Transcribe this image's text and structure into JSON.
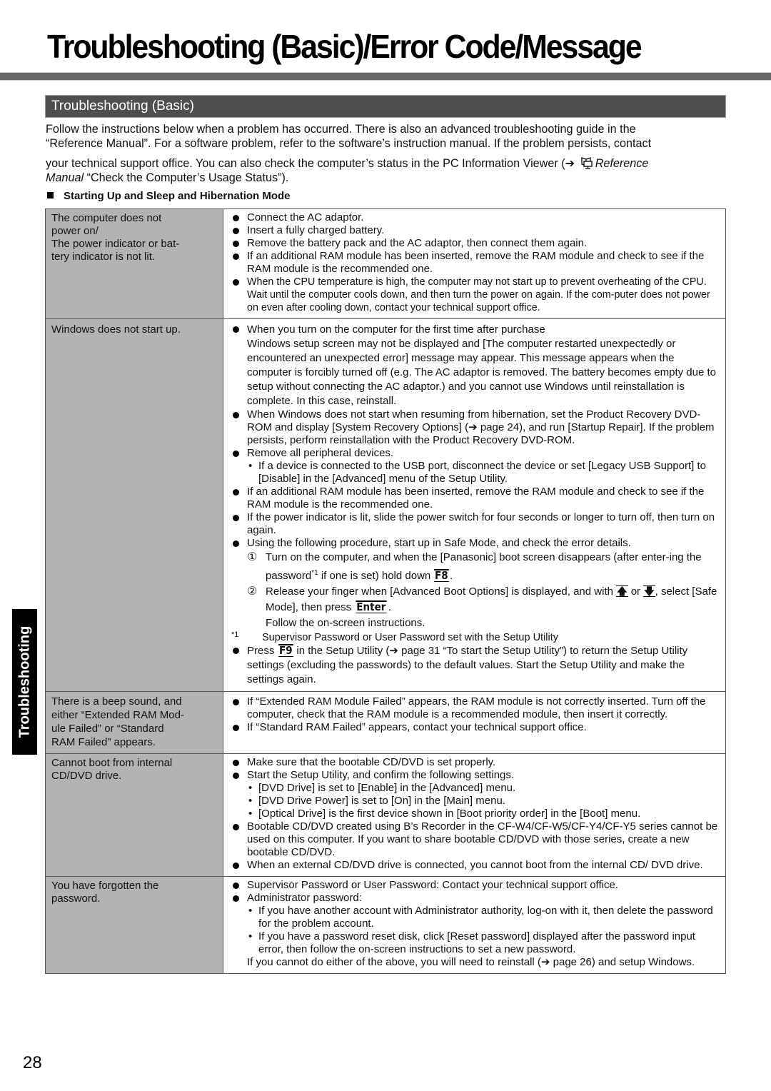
{
  "page": {
    "title": "Troubleshooting (Basic)/Error Code/Message",
    "section_title": "Troubleshooting (Basic)",
    "side_tab": "Troubleshooting",
    "page_number": "28"
  },
  "intro": {
    "line1": "Follow the instructions below when a problem has occurred. There is also an advanced troubleshooting guide in the",
    "line2": "“Reference Manual”. For a software problem, refer to the software’s instruction manual. If the problem persists, contact",
    "line3_pre": "your technical support office. You can also check the computer’s status in the PC Information Viewer (",
    "line3_arrow": "➔",
    "reference_icon": "reference-manual-icon",
    "line3_italic": "Reference",
    "line4_italic": "Manual",
    "line4_rest": " “Check the Computer’s Usage Status”)."
  },
  "subsection": {
    "title": "Starting Up and Sleep and Hibernation Mode"
  },
  "rows": [
    {
      "problem": [
        "The computer does not",
        "power on/",
        "The power indicator or bat-",
        "tery indicator is not lit."
      ],
      "solutions": [
        "Connect the AC adaptor.",
        "Insert a fully charged battery.",
        "Remove the battery pack and the AC adaptor, then connect them again.",
        "If an additional RAM module has been inserted, remove the RAM module and check to see if the RAM module is the recommended one.",
        "When the CPU temperature is high, the computer may not start up to prevent overheating of the CPU. Wait until the computer cools down, and then turn the power on again. If the com-puter does not power on even after cooling down, contact your technical support office."
      ]
    },
    {
      "problem": [
        "Windows does not start up."
      ],
      "solutions": {
        "s1_head": "When you turn on the computer for the first time after purchase",
        "s1_body": "Windows setup screen may not be displayed and [The computer restarted unexpectedly or encountered an unexpected error] message may appear. This message appears when the computer is forcibly turned off (e.g. The AC adaptor is removed. The battery becomes empty due to setup without connecting the AC adaptor.) and you cannot use Windows until reinstallation is complete. In this case, reinstall.",
        "s2": "When Windows does not start when resuming from hibernation, set the Product Recovery DVD-ROM and display [System Recovery Options] (➔ page 24), and run [Startup Repair]. If the problem persists, perform reinstallation with the Product Recovery DVD-ROM.",
        "s3": "Remove all peripheral devices.",
        "s3_sub": "If a device is connected to the USB port, disconnect the device or set [Legacy USB Support] to [Disable] in the [Advanced] menu of the Setup Utility.",
        "s4": "If an additional RAM module has been inserted, remove the RAM module and check to see if the RAM module is the recommended one.",
        "s5": "If the power indicator is lit, slide the power switch for four seconds or longer to turn off, then turn on again.",
        "s6": "Using the following procedure, start up in Safe Mode, and check the error details.",
        "step1_num": "①",
        "step1_pre": "Turn on the computer, and when the [Panasonic] boot screen disappears (after enter-ing the password",
        "step1_sup": "*1",
        "step1_mid": " if one is set) hold down ",
        "step1_key": "F8",
        "step1_end": ".",
        "step2_num": "②",
        "step2_pre": "Release your finger when [Advanced Boot Options] is displayed, and with ",
        "step2_key_up": "🡅",
        "step2_or": " or ",
        "step2_key_down": "🡇",
        "step2_mid": ", select [Safe Mode], then press ",
        "step2_key_enter": "Enter",
        "step2_end": ".",
        "step2_follow": "Follow the on-screen instructions.",
        "footnote_mark": "*1",
        "footnote_text": "Supervisor Password or User Password set with the Setup Utility",
        "s7_pre": "Press ",
        "s7_key": "F9",
        "s7_post": " in the Setup Utility (➔ page 31 “To start the Setup Utility”) to return the Setup Utility settings (excluding the passwords) to the default values. Start the Setup Utility and make the settings again."
      }
    },
    {
      "problem": [
        "There is a beep sound, and",
        "either “Extended RAM Mod-",
        "ule Failed” or “Standard",
        "RAM Failed” appears."
      ],
      "solutions": [
        "If “Extended RAM Module Failed” appears, the RAM module is not correctly inserted. Turn off the computer, check that the RAM module is a recommended module, then insert it correctly.",
        "If “Standard RAM Failed” appears, contact your technical support office."
      ]
    },
    {
      "problem": [
        "Cannot boot from internal",
        "CD/DVD drive."
      ],
      "solutions": {
        "s1": "Make sure that the bootable CD/DVD is set properly.",
        "s2": "Start the Setup Utility, and confirm the following settings.",
        "s2_sub": [
          "[DVD Drive] is set to [Enable] in the [Advanced] menu.",
          "[DVD Drive Power] is set to [On] in the [Main] menu.",
          "[Optical Drive] is the first device shown in [Boot priority order] in the [Boot] menu."
        ],
        "s3": "Bootable CD/DVD created using B’s Recorder in the CF-W4/CF-W5/CF-Y4/CF-Y5 series cannot be used on this computer. If you want to share bootable CD/DVD with those series, create a new bootable CD/DVD.",
        "s4": "When an external CD/DVD drive is connected, you cannot boot from the internal CD/ DVD drive."
      }
    },
    {
      "problem": [
        "You have forgotten the",
        "password."
      ],
      "solutions": {
        "s1": "Supervisor Password or User Password: Contact your technical support office.",
        "s2": "Administrator password:",
        "s2_sub": [
          "If you have another account with Administrator authority, log-on with it, then delete the password for the problem account.",
          "If you have a password reset disk, click [Reset password] displayed after the password input error, then follow the on-screen instructions to set a new password."
        ],
        "tail": "If you cannot do either of the above, you will need to reinstall (➔ page 26) and setup Windows."
      }
    }
  ]
}
